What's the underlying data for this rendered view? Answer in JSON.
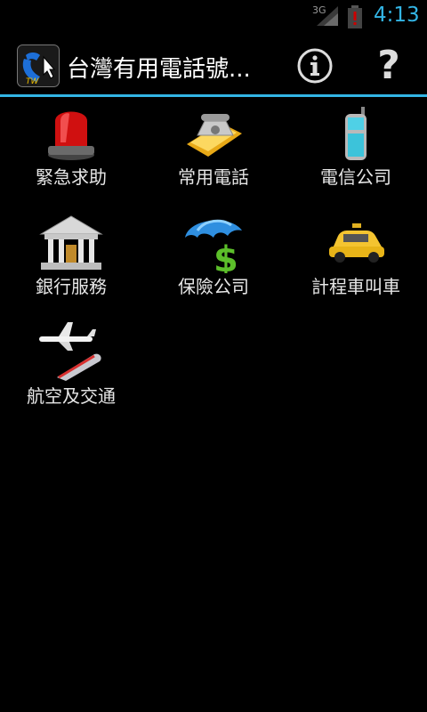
{
  "status_bar": {
    "network": "3G",
    "clock": "4:13"
  },
  "app": {
    "title": "台灣有用電話號...",
    "icon_text": "TW"
  },
  "actions": {
    "help_label": "?"
  },
  "grid": [
    {
      "label": "緊急求助",
      "icon": "siren-icon"
    },
    {
      "label": "常用電話",
      "icon": "telephone-icon"
    },
    {
      "label": "電信公司",
      "icon": "mobile-phone-icon"
    },
    {
      "label": "銀行服務",
      "icon": "bank-icon"
    },
    {
      "label": "保險公司",
      "icon": "umbrella-money-icon"
    },
    {
      "label": "計程車叫車",
      "icon": "taxi-icon"
    },
    {
      "label": "航空及交通",
      "icon": "plane-train-icon"
    }
  ],
  "colors": {
    "accent": "#33b5e5",
    "background": "#000000",
    "battery_alert": "#cc0000"
  }
}
